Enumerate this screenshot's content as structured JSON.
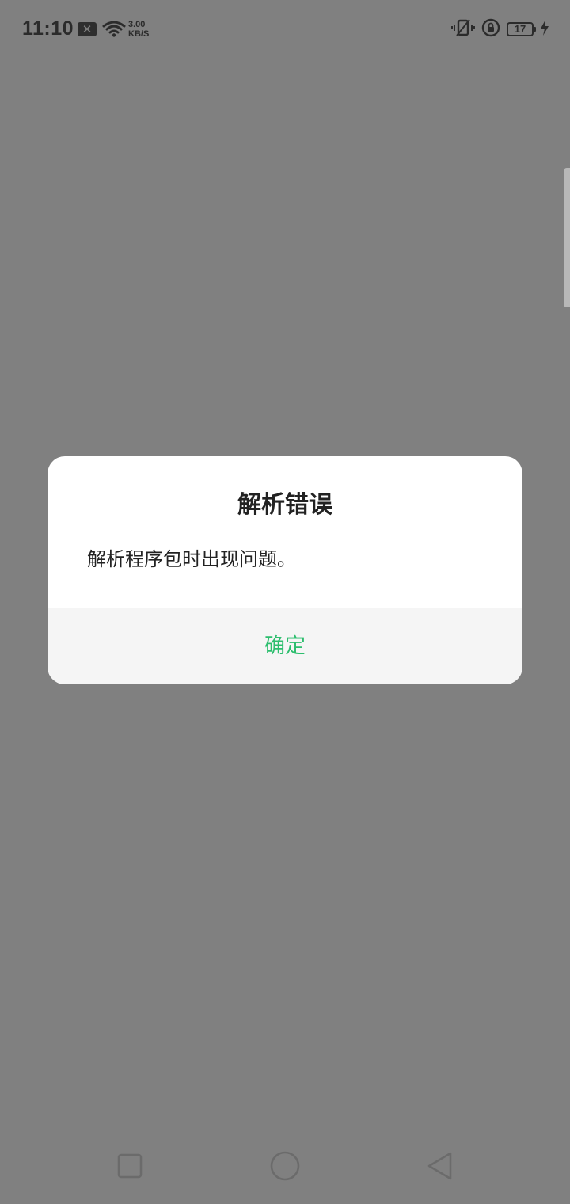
{
  "status_bar": {
    "time": "11:10",
    "notification_icon": "close-box-icon",
    "network_speed_value": "3.00",
    "network_speed_unit": "KB/S",
    "battery_level": "17",
    "icons": [
      "vibrate-icon",
      "rotation-lock-icon",
      "battery-icon",
      "charging-icon",
      "wifi-icon"
    ]
  },
  "dialog": {
    "title": "解析错误",
    "message": "解析程序包时出现问题。",
    "confirm_label": "确定",
    "accent_color": "#2dbe6e"
  },
  "nav_bar": {
    "buttons": [
      "recents-button",
      "home-button",
      "back-button"
    ]
  }
}
